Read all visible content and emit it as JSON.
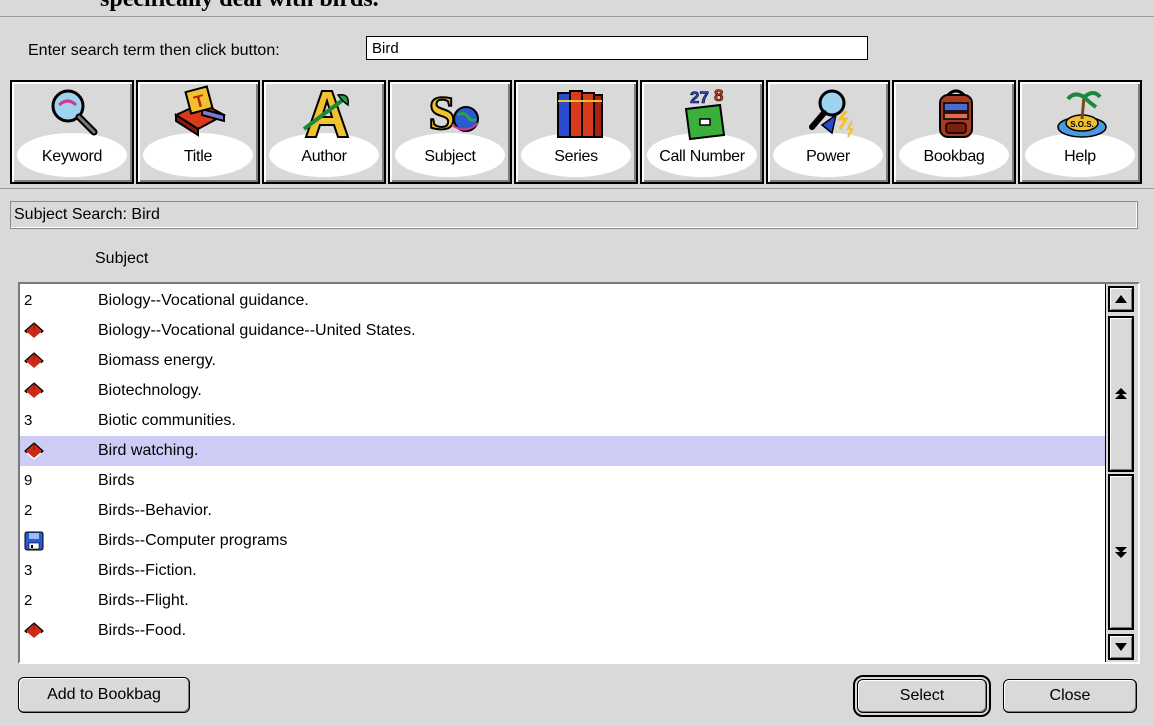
{
  "page_caption": "specifically deal with birds.",
  "search": {
    "label": "Enter search term then click button:",
    "value": "Bird"
  },
  "toolbar": [
    {
      "label": "Keyword",
      "icon": "magnifier-icon"
    },
    {
      "label": "Title",
      "icon": "title-book-icon"
    },
    {
      "label": "Author",
      "icon": "author-quill-icon"
    },
    {
      "label": "Subject",
      "icon": "subject-globe-icon"
    },
    {
      "label": "Series",
      "icon": "series-books-icon"
    },
    {
      "label": "Call Number",
      "icon": "call-number-box-icon"
    },
    {
      "label": "Power",
      "icon": "power-lightning-icon"
    },
    {
      "label": "Bookbag",
      "icon": "bookbag-icon"
    },
    {
      "label": "Help",
      "icon": "sos-island-icon"
    }
  ],
  "status": "Subject Search: Bird",
  "column_header": "Subject",
  "rows": [
    {
      "count": "2",
      "icon": "",
      "text": "Biology--Vocational guidance.",
      "selected": false
    },
    {
      "count": "",
      "icon": "book-icon",
      "text": "Biology--Vocational guidance--United States.",
      "selected": false
    },
    {
      "count": "",
      "icon": "book-icon",
      "text": "Biomass energy.",
      "selected": false
    },
    {
      "count": "",
      "icon": "book-icon",
      "text": "Biotechnology.",
      "selected": false
    },
    {
      "count": "3",
      "icon": "",
      "text": "Biotic communities.",
      "selected": false
    },
    {
      "count": "",
      "icon": "book-icon",
      "text": "Bird watching.",
      "selected": true
    },
    {
      "count": "9",
      "icon": "",
      "text": "Birds",
      "selected": false
    },
    {
      "count": "2",
      "icon": "",
      "text": "Birds--Behavior.",
      "selected": false
    },
    {
      "count": "",
      "icon": "floppy-disk-icon",
      "text": "Birds--Computer programs",
      "selected": false
    },
    {
      "count": "3",
      "icon": "",
      "text": "Birds--Fiction.",
      "selected": false
    },
    {
      "count": "2",
      "icon": "",
      "text": "Birds--Flight.",
      "selected": false
    },
    {
      "count": "",
      "icon": "book-icon",
      "text": "Birds--Food.",
      "selected": false
    }
  ],
  "buttons": {
    "add": "Add to Bookbag",
    "select": "Select",
    "close": "Close"
  },
  "colors": {
    "selection": "#ccccf5",
    "book_red": "#cc2a14",
    "window_bg": "#d9d9d9"
  }
}
